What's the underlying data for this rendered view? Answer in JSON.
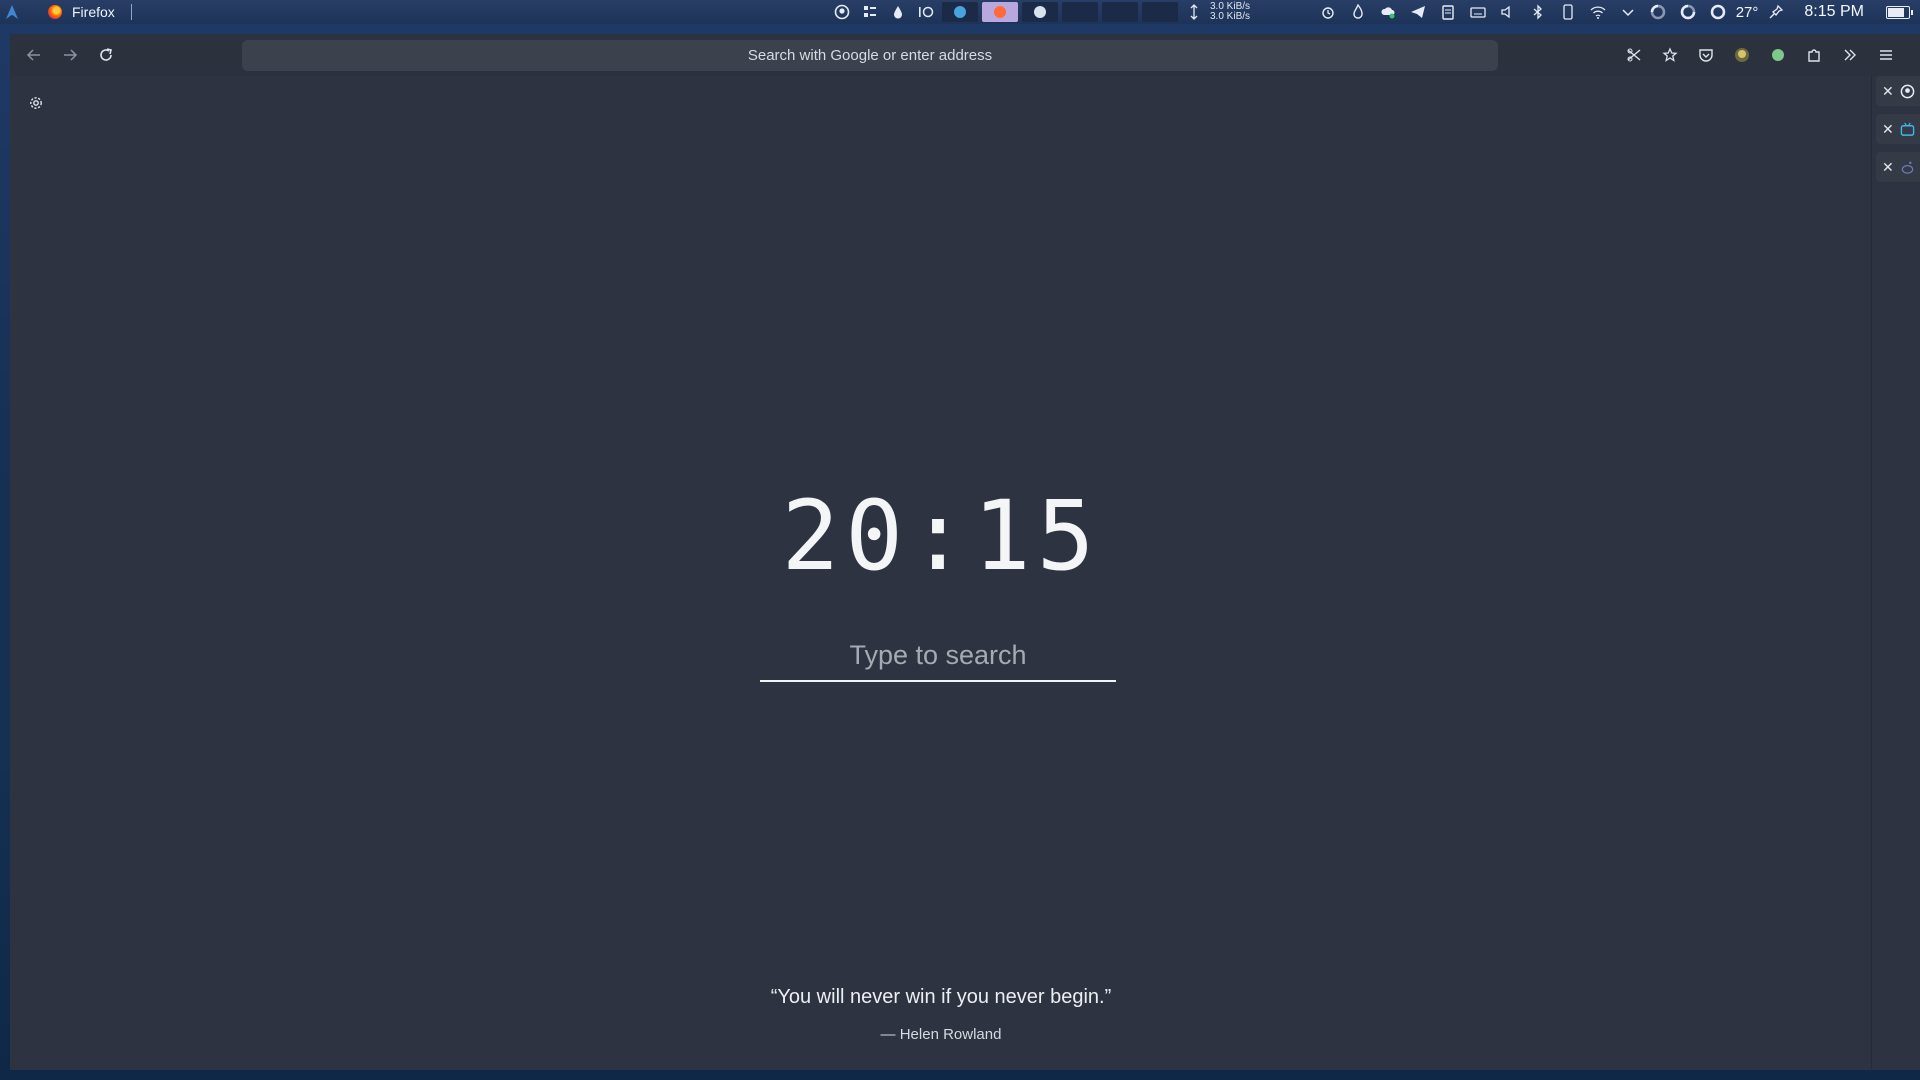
{
  "panel": {
    "app_title": "Firefox",
    "net_up": "3.0 KiB/s",
    "net_down": "3.0 KiB/s",
    "temperature": "27°",
    "clock": "8:15 PM",
    "battery_level": 0.85,
    "mid_icons": [
      "github-icon",
      "grid-menu-icon",
      "drop-icon",
      "io-label",
      "ring-icon"
    ],
    "right_icons": [
      "alarm-icon",
      "flame-icon",
      "cloud-sync-icon",
      "telegram-icon",
      "clipboard-icon",
      "keyboard-icon",
      "volume-icon",
      "bluetooth-icon",
      "phone-icon",
      "wifi-icon",
      "chevron-down-icon",
      "cpu-gauge-icon",
      "ram-gauge-icon",
      "ring-icon",
      "pin-icon"
    ]
  },
  "browser": {
    "url_placeholder": "Search with Google or enter address",
    "nav": [
      "back-icon",
      "forward-icon",
      "reload-icon"
    ],
    "toolbar_icons": [
      "screenshot-icon",
      "bookmark-star-icon",
      "pocket-icon",
      "avatar-icon",
      "extension-green-dot-icon",
      "extensions-icon",
      "overflow-icon",
      "hamburger-menu-icon"
    ],
    "side_tabs": [
      {
        "icon": "github-icon"
      },
      {
        "icon": "tv-icon"
      },
      {
        "icon": "reddit-icon"
      }
    ]
  },
  "newtab": {
    "time": "20:15",
    "search_placeholder": "Type to search",
    "quote": "“You will never win if you never begin.”",
    "author": "— Helen Rowland"
  },
  "colors": {
    "page_bg": "#2d3340",
    "toolbar_bg": "#2b313d",
    "urlbar_bg": "#3b414d",
    "panel_bg": "#1d3358",
    "active_task": "#b9a8de"
  }
}
